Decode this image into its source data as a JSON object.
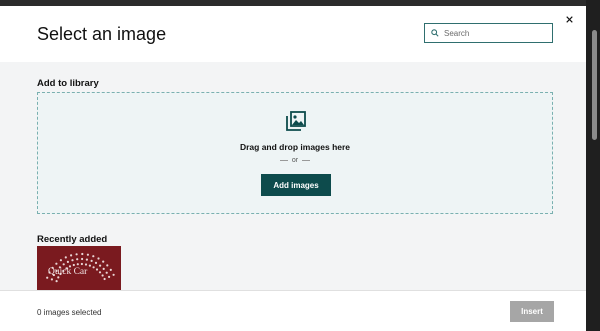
{
  "modal": {
    "title": "Select an image",
    "search": {
      "placeholder": "Search",
      "value": ""
    },
    "close_icon": "close-icon"
  },
  "add_section": {
    "title": "Add to library",
    "drop_icon": "image-gallery-icon",
    "drop_text": "Drag and drop images here",
    "or_text": "or",
    "add_button_label": "Add images"
  },
  "recent_section": {
    "title": "Recently added",
    "items": [
      {
        "thumbnail_text": "Quick Car"
      }
    ]
  },
  "footer": {
    "selected_text": "0 images selected",
    "insert_label": "Insert",
    "insert_enabled": false
  },
  "colors": {
    "accent": "#0d4b4c",
    "dropzone_bg": "#eef4f5",
    "thumbnail_bg": "#7a1a1f"
  }
}
